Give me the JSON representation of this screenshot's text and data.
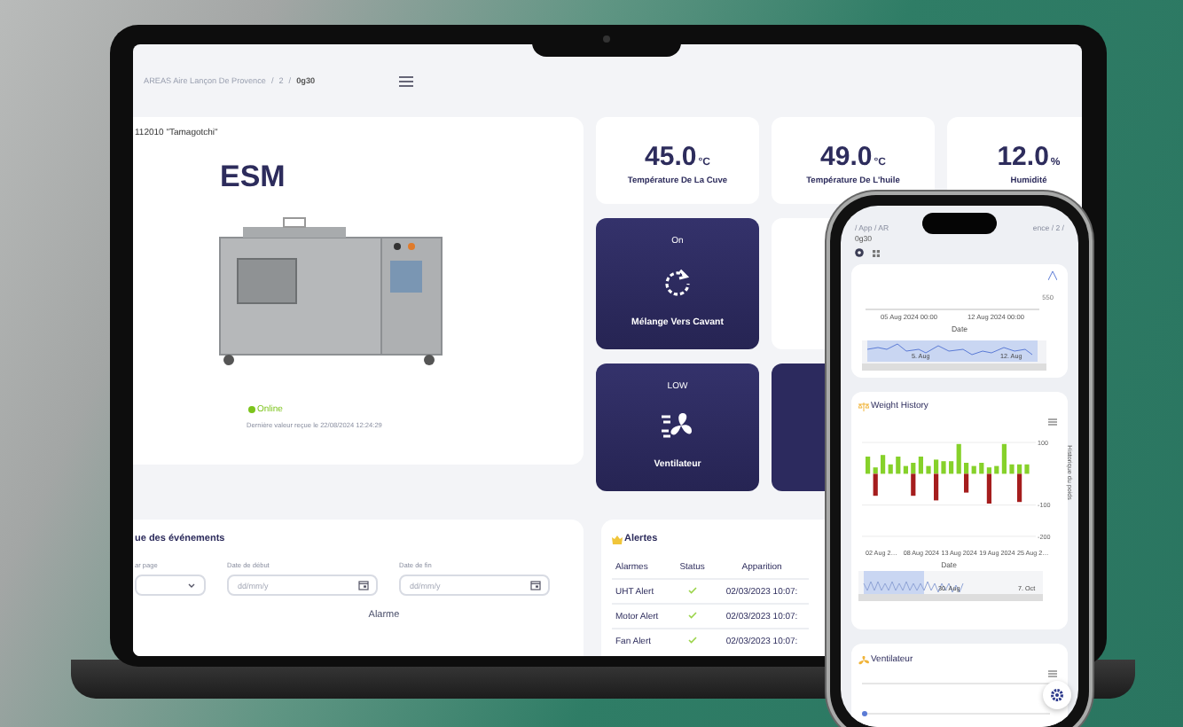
{
  "laptop": {
    "breadcrumb": {
      "separator": "/",
      "items": [
        "AREAS Aire Lançon De Provence",
        "2",
        "0g30"
      ]
    },
    "device_card": {
      "id_label": "112010 \"Tamagotchi\"",
      "name": "ESM",
      "online": true,
      "status": "Online",
      "last_value": "Dernière valeur reçue le 22/08/2024 12:24:29"
    },
    "stats": [
      {
        "value": "45.0",
        "unit": "°C",
        "label": "Température De La Cuve"
      },
      {
        "value": "49.0",
        "unit": "°C",
        "label": "Température De L'huile"
      },
      {
        "value": "12.0",
        "unit": "%",
        "label": "Humidité"
      }
    ],
    "controls": [
      {
        "kind": "rotate",
        "state": "On",
        "label": "Mélange Vers Cavant"
      },
      {
        "kind": "fan",
        "state": "LOW",
        "label": "Ventilateur"
      }
    ],
    "events": {
      "title": "ue des événements",
      "fields": [
        {
          "kind": "select",
          "label": "ar page"
        },
        {
          "kind": "date",
          "label": "Date de début",
          "placeholder": "dd/mm/y"
        },
        {
          "kind": "date",
          "label": "Date de fin",
          "placeholder": "dd/mm/y"
        }
      ],
      "column": "Alarme"
    },
    "alerts": {
      "title": "Alertes",
      "columns": [
        "Alarmes",
        "Status",
        "Apparition"
      ],
      "rows": [
        {
          "name": "UHT Alert",
          "ok": true,
          "time": "02/03/2023 10:07:"
        },
        {
          "name": "Motor Alert",
          "ok": true,
          "time": "02/03/2023 10:07:"
        },
        {
          "name": "Fan Alert",
          "ok": true,
          "time": "02/03/2023 10:07:"
        }
      ]
    }
  },
  "phone": {
    "breadcrumb": [
      "/ App / AR",
      "ence / 2 /",
      "0g30"
    ],
    "history_card": {
      "ytick": "550",
      "dates": [
        "05 Aug 2024 00:00",
        "12 Aug 2024 00:00"
      ],
      "xlabel": "Date",
      "navigator": [
        "5. Aug",
        "12. Aug"
      ]
    },
    "weight_card": {
      "title": "Weight History",
      "navigator": [
        "30. Aug",
        "7. Oct"
      ],
      "xlabel": "Date",
      "ylabel": "Historique du poids",
      "ytick_labels": [
        "100",
        "-100",
        "-200"
      ],
      "xtick_labels": [
        "02 Aug 2…",
        "08 Aug 2024",
        "13 Aug 2024",
        "19 Aug 2024",
        "25 Aug 2…"
      ]
    },
    "fan_card": {
      "title": "Ventilateur"
    }
  }
}
